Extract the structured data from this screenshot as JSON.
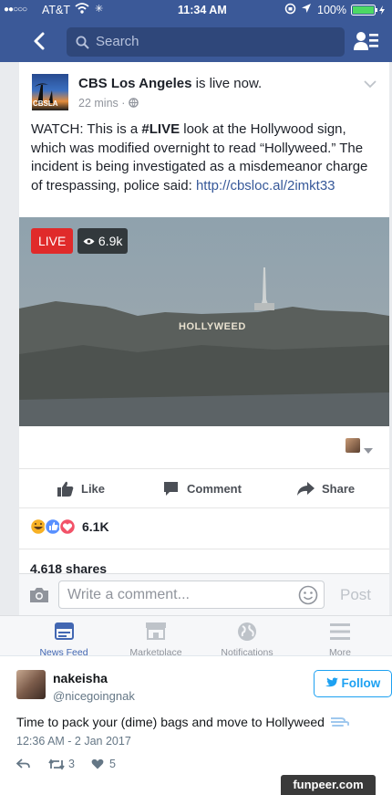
{
  "status": {
    "signal": "●●○○○",
    "carrier": "AT&T",
    "time": "11:34 AM",
    "battery": "100%"
  },
  "nav": {
    "search_placeholder": "Search"
  },
  "post": {
    "page_name": "CBS Los Angeles",
    "action": " is live now.",
    "time": "22 mins",
    "logo_text": "CBSLA",
    "text_before": "WATCH: This is a ",
    "text_bold": "#LIVE",
    "text_after": " look at the Hollywood sign, which was modified overnight to read “Hollyweed.” The incident is being investigated as a misdemeanor charge of trespassing, police said: ",
    "link": "http://cbsloc.al/2imkt33",
    "live_label": "LIVE",
    "viewers": "6.9k",
    "sign_text": "HOLLYWEED",
    "reactions_count": "6.1K",
    "shares": "4,618 shares"
  },
  "actions": {
    "like": "Like",
    "comment": "Comment",
    "share": "Share"
  },
  "comment": {
    "placeholder": "Write a comment...",
    "post": "Post"
  },
  "tabs": [
    "News Feed",
    "Marketplace",
    "Notifications",
    "More"
  ],
  "tweet": {
    "name": "nakeisha",
    "handle": "@nicegoingnak",
    "follow": "Follow",
    "text": "Time to pack your (dime) bags and move to Hollyweed",
    "timestamp": "12:36 AM - 2 Jan 2017",
    "retweets": "3",
    "likes": "5"
  },
  "watermark": "funpeer.com",
  "colors": {
    "facebook_blue": "#3b5998",
    "live_red": "#e02a2a",
    "twitter_blue": "#1da1f2"
  }
}
